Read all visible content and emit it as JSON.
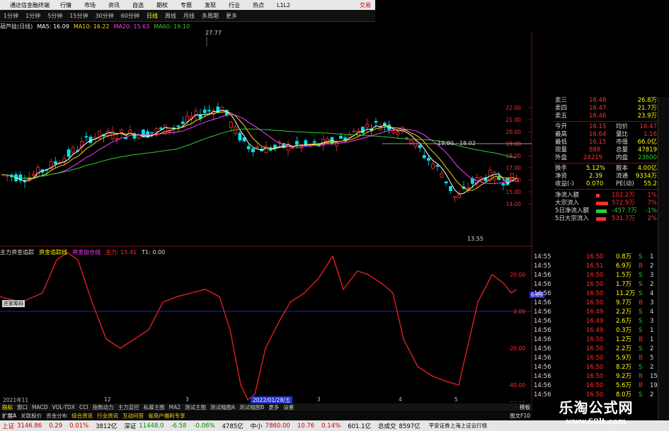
{
  "menu": {
    "app_title": "通达信金融终端",
    "items": [
      "行情",
      "市场",
      "资讯",
      "自选",
      "期权",
      "专题",
      "发现",
      "行业",
      "热点",
      "L1L2"
    ],
    "account": "交易"
  },
  "toolbar": {
    "items": [
      "日线",
      "1分钟",
      "1分钟",
      "5分钟",
      "15分钟",
      "30分钟",
      "60分钟",
      "日线",
      "周线",
      "月线",
      "多周期",
      "更多"
    ],
    "active": "日线"
  },
  "legend": {
    "stock": "葫芦娃(日线)",
    "ma5": "MA5: 16.09",
    "ma10": "MA10: 16.22",
    "ma20": "MA20: 15.63",
    "ma60": "MA60: 19.10"
  },
  "price_annotations": {
    "high_label": "27.77",
    "low_label": "13.55",
    "crosshair_label": "19.00 - 18.02"
  },
  "price_axis": [
    "22.00",
    "21.00",
    "20.00",
    "19.00",
    "18.00",
    "17.00",
    "16.00",
    "15.00",
    "14.00"
  ],
  "indicator_legend": {
    "name": "主力资金追踪",
    "p1": "资金追踪线",
    "p2": "资金加仓线",
    "p3": "主力: 15.41",
    "t1": "T1: 0.00"
  },
  "indicator_axis": [
    "20.00",
    "0.00",
    "-20.00",
    "-40.00",
    "-50.00"
  ],
  "indicator_tag": "6.89",
  "indicator_tooltip": "庄家筹码",
  "date_axis": {
    "left": "2021年11",
    "ticks": [
      "12",
      "3",
      "2",
      "3",
      "4",
      "5"
    ],
    "highlight": "2022/01/28/五"
  },
  "quote": {
    "sell_rows": [
      {
        "label": "卖三",
        "price": "16.48",
        "vol": "26.8万"
      },
      {
        "label": "卖四",
        "price": "16.47",
        "vol": "21.7万"
      },
      {
        "label": "卖五",
        "price": "16.46",
        "vol": "23.9万"
      }
    ],
    "rows": [
      {
        "l1": "今开",
        "v1": "16.15",
        "l2": "均价",
        "v2": "16.47"
      },
      {
        "l1": "最高",
        "v1": "16.64",
        "l2": "量比",
        "v2": "1.16"
      },
      {
        "l1": "最低",
        "v1": "16.15",
        "l2": "市值",
        "v2": "66.0亿"
      },
      {
        "l1": "现量",
        "v1": "888",
        "l2": "总量",
        "v2": "47819"
      },
      {
        "l1": "外盘",
        "v1": "24219",
        "l2": "内盘",
        "v2": "23600"
      },
      {
        "l1": "换手",
        "v1": "5.12%",
        "l2": "股本",
        "v2": "4.00亿"
      },
      {
        "l1": "净资",
        "v1": "2.39",
        "l2": "流通",
        "v2": "9334万"
      },
      {
        "l1": "收益(-)",
        "v1": "0.070",
        "l2": "PE(动)",
        "v2": "55.2"
      }
    ],
    "flows": [
      {
        "label": "净流入额",
        "value": "102.2万",
        "pct": "1%",
        "bar": 0.18
      },
      {
        "label": "大宗流入",
        "value": "572.9万",
        "pct": "7%",
        "bar": 0.55
      },
      {
        "label": "5日净流入额",
        "value": "-457.7万",
        "pct": "-1%",
        "bar": 0.5
      },
      {
        "label": "5日大宗流入",
        "value": "531.7万",
        "pct": "2%",
        "bar": 0.45
      }
    ]
  },
  "ticks": [
    {
      "time": "14:55",
      "price": "16.50",
      "vol": "0.8万",
      "bs": "S",
      "n": "1"
    },
    {
      "time": "14:55",
      "price": "16.51",
      "vol": "6.9万",
      "bs": "B",
      "n": "2"
    },
    {
      "time": "14:56",
      "price": "16.50",
      "vol": "1.5万",
      "bs": "S",
      "n": "3"
    },
    {
      "time": "14:56",
      "price": "16.50",
      "vol": "1.7万",
      "bs": "S",
      "n": "2"
    },
    {
      "time": "14:56",
      "price": "16.50",
      "vol": "11.2万",
      "bs": "S",
      "n": "4"
    },
    {
      "time": "14:56",
      "price": "16.50",
      "vol": "9.7万",
      "bs": "B",
      "n": "3"
    },
    {
      "time": "14:56",
      "price": "16.49",
      "vol": "2.2万",
      "bs": "S",
      "n": "4"
    },
    {
      "time": "14:56",
      "price": "16.49",
      "vol": "2.6万",
      "bs": "S",
      "n": "3"
    },
    {
      "time": "14:56",
      "price": "16.49",
      "vol": "0.3万",
      "bs": "S",
      "n": "1"
    },
    {
      "time": "14:56",
      "price": "16.50",
      "vol": "1.2万",
      "bs": "B",
      "n": "1"
    },
    {
      "time": "14:56",
      "price": "16.50",
      "vol": "2.2万",
      "bs": "S",
      "n": "2"
    },
    {
      "time": "14:56",
      "price": "16.50",
      "vol": "5.9万",
      "bs": "B",
      "n": "5"
    },
    {
      "time": "14:56",
      "price": "16.50",
      "vol": "8.2万",
      "bs": "S",
      "n": "2"
    },
    {
      "time": "14:56",
      "price": "16.50",
      "vol": "9.2万",
      "bs": "B",
      "n": "15"
    },
    {
      "time": "14:56",
      "price": "16.50",
      "vol": "5.6万",
      "bs": "B",
      "n": "19"
    },
    {
      "time": "14:56",
      "price": "16.50",
      "vol": "8.0万",
      "bs": "S",
      "n": "2"
    }
  ],
  "bottom_tabs": [
    "指标",
    "窗口",
    "MACD",
    "VOL-TDX",
    "CCI",
    "指数动力",
    "主力监控",
    "私募主图",
    "MA2",
    "测试主图",
    "测试幅图A",
    "测试幅图B",
    "更多",
    "设置"
  ],
  "bottom_tabs2": [
    "扩展A",
    "关联股价",
    "资金分布",
    "综合资讯",
    "行业资讯",
    "互动问答",
    "省商户福利专享"
  ],
  "bottom_right": [
    "图文F10",
    "模板"
  ],
  "status": {
    "sh_label": "上证",
    "sh_val": "3146.86",
    "sh_chg": "0.29",
    "sh_pct": "0.01%",
    "sh_amt": "3812亿",
    "sz_label": "深证",
    "sz_val": "11448.0",
    "sz_chg": "-6.58",
    "sz_pct": "-0.06%",
    "sz_amt": "4785亿",
    "zx_label": "中小",
    "zx_val": "7860.00",
    "zx_chg": "10.76",
    "zx_pct": "0.14%",
    "zx_amt": "601.1亿",
    "total_label": "总成交",
    "total_val": "8597亿",
    "broker": "平安证券上海上证云行情"
  },
  "watermark": {
    "title": "乐淘公式网",
    "url": "www.60lt.com"
  },
  "colors": {
    "up": "#ff3030",
    "down": "#00e5e5",
    "ma5": "#ffffff",
    "ma10": "#ffd700",
    "ma20": "#ff3cff",
    "ma60": "#2fcf2f",
    "indicator": "#e02020",
    "yellow": "#ffff00"
  }
}
